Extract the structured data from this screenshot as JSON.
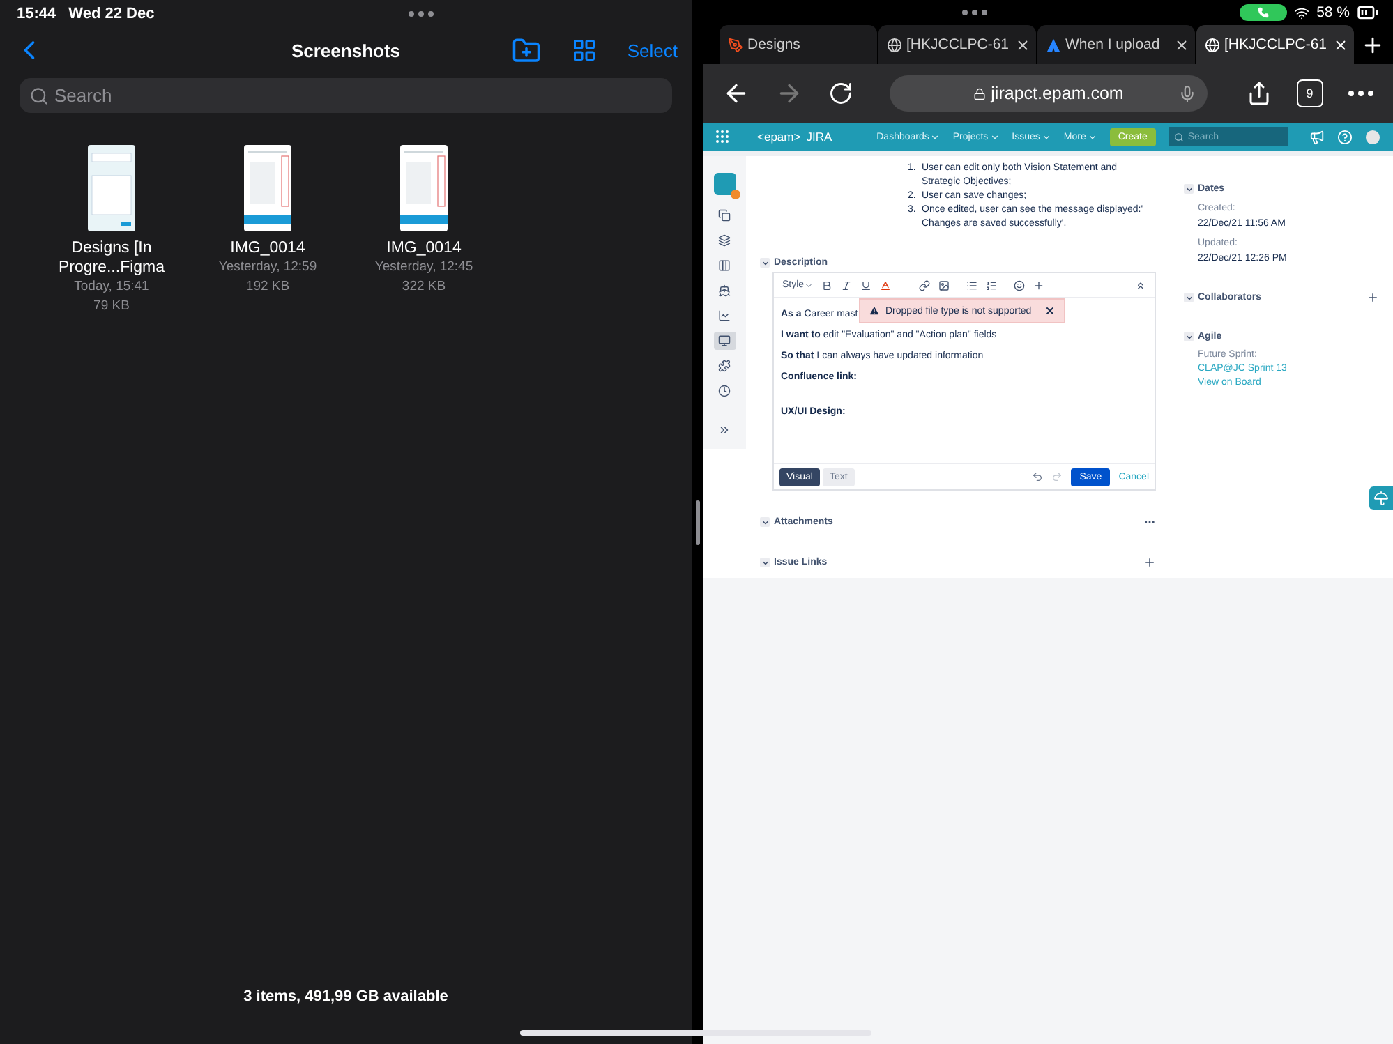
{
  "status_bar": {
    "time": "15:44",
    "date": "Wed 22 Dec",
    "battery": "58 %"
  },
  "files": {
    "title": "Screenshots",
    "select": "Select",
    "search": {
      "placeholder": "Search"
    },
    "items": [
      {
        "name": "Designs [In Progre...Figma",
        "date": "Today, 15:41",
        "size": "79 KB",
        "kind": "form"
      },
      {
        "name": "IMG_0014",
        "date": "Yesterday, 12:59",
        "size": "192 KB",
        "kind": "table"
      },
      {
        "name": "IMG_0014",
        "date": "Yesterday, 12:45",
        "size": "322 KB",
        "kind": "table"
      }
    ],
    "footer": "3 items, 491,99 GB available"
  },
  "browser": {
    "tabs": [
      {
        "title": "Designs",
        "kind": "figma",
        "selected": false,
        "closable": false
      },
      {
        "title": "[HKJCCLPC-61",
        "kind": "globe",
        "selected": false,
        "closable": true
      },
      {
        "title": "When I upload",
        "kind": "atlassian",
        "selected": false,
        "closable": true
      },
      {
        "title": "[HKJCCLPC-61",
        "kind": "globe",
        "selected": true,
        "closable": true
      }
    ],
    "address": "jirapct.epam.com",
    "tab_count": "9"
  },
  "jira": {
    "brand": "<epam>",
    "product": "JIRA",
    "nav": [
      "Dashboards",
      "Projects",
      "Issues",
      "More"
    ],
    "create": "Create",
    "search": {
      "placeholder": "Search"
    },
    "sidebar": [
      {
        "kind": "avatar",
        "selected": false
      },
      {
        "kind": "copy",
        "selected": false
      },
      {
        "kind": "stack",
        "selected": false
      },
      {
        "kind": "columns",
        "selected": false
      },
      {
        "kind": "ship",
        "selected": false
      },
      {
        "kind": "chart",
        "selected": false
      },
      {
        "kind": "monitor",
        "selected": true
      },
      {
        "kind": "puzzle",
        "selected": false
      },
      {
        "kind": "clock",
        "selected": false
      },
      {
        "kind": "expand",
        "selected": false
      }
    ],
    "criteria": [
      {
        "number": "1.",
        "text": "User can edit only both Vision Statement and Strategic Objectives;"
      },
      {
        "number": "2.",
        "text": "User can save changes;"
      },
      {
        "number": "3.",
        "text": "Once edited, user can see the message displayed:' Changes are saved successfully'."
      }
    ],
    "description": {
      "title": "Description",
      "expanded": true,
      "style_label": "Style",
      "paragraphs": [
        {
          "kind": "sentence",
          "text": "**As a** Career mast"
        },
        {
          "kind": "sentence",
          "text": "**I want to** edit \"Evaluation\" and \"Action plan\" fields"
        },
        {
          "kind": "sentence",
          "text": "**So that** I can always have updated information"
        },
        {
          "kind": "heading",
          "text": "Confluence link:"
        },
        {
          "kind": "heading",
          "text": "UX/UI Design:"
        }
      ],
      "toast": "Dropped file type is not supported",
      "modes": [
        {
          "label": "Visual",
          "selected": true
        },
        {
          "label": "Text",
          "selected": false
        }
      ],
      "save": "Save",
      "cancel": "Cancel"
    },
    "attachments": {
      "title": "Attachments",
      "expanded": true
    },
    "issue_links": {
      "title": "Issue Links",
      "expanded": true
    },
    "dates": {
      "title": "Dates",
      "expanded": true,
      "fields": [
        {
          "label": "Created:",
          "value": "22/Dec/21 11:56 AM"
        },
        {
          "label": "Updated:",
          "value": "22/Dec/21 12:26 PM"
        }
      ]
    },
    "collaborators": {
      "title": "Collaborators",
      "expanded": true
    },
    "agile": {
      "title": "Agile",
      "expanded": true,
      "label": "Future Sprint:",
      "links": [
        "CLAP@JC Sprint 13",
        "View on Board"
      ]
    }
  }
}
